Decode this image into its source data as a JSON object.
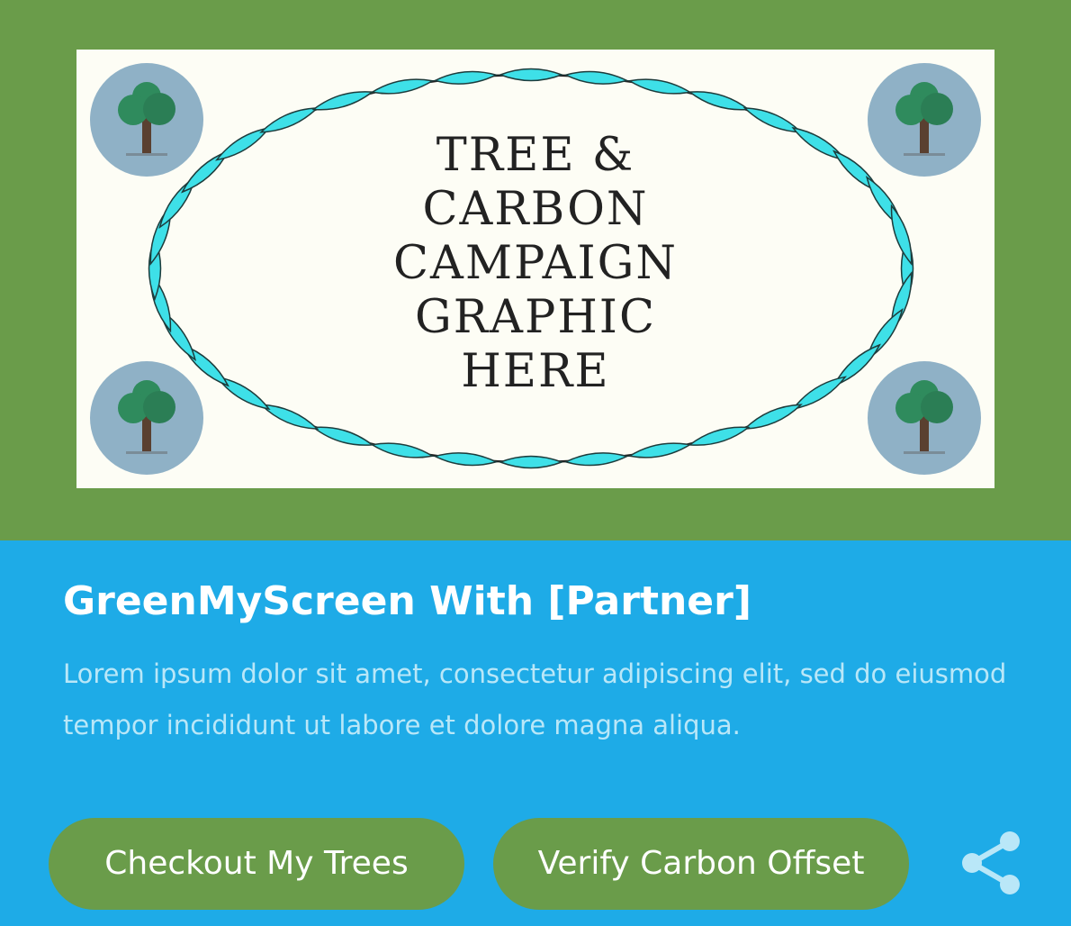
{
  "hero": {
    "graphic_lines": [
      "TREE &",
      "CARBON",
      "CAMPAIGN",
      "GRAPHIC",
      "HERE"
    ]
  },
  "card": {
    "title": "GreenMyScreen With [Partner]",
    "description": "Lorem ipsum dolor sit amet, consectetur adipiscing elit, sed do eiusmod tempor incididunt ut labore et dolore magna aliqua."
  },
  "actions": {
    "checkout_label": "Checkout My Trees",
    "verify_label": "Verify Carbon Offset",
    "share_icon": "share-icon"
  },
  "colors": {
    "hero_background": "#6a9c4a",
    "info_background": "#1eabe7",
    "button_background": "#6a9c4a",
    "wreath_leaf": "#3ee0e8",
    "badge_circle": "#8fb1c6"
  }
}
